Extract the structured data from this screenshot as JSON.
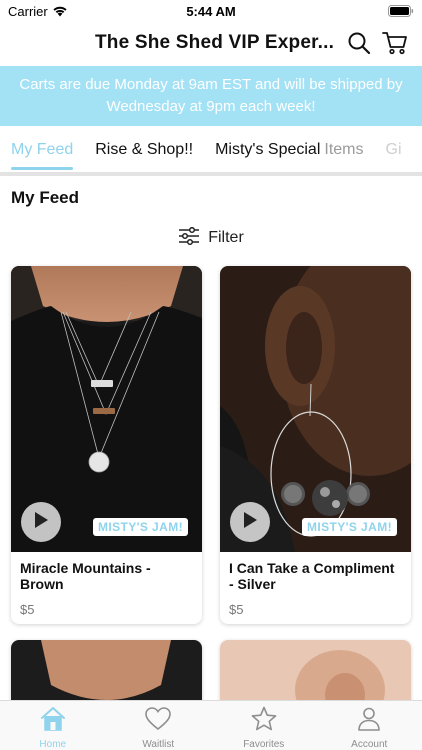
{
  "status_bar": {
    "carrier": "Carrier",
    "time": "5:44 AM"
  },
  "header": {
    "title": "The She Shed  VIP Exper..."
  },
  "banner": {
    "text": "Carts are due Monday at 9am EST and will be shipped by Wednesday at 9pm each week!"
  },
  "tabs": [
    {
      "label": "My Feed",
      "active": true
    },
    {
      "label": "Rise & Shop!!"
    },
    {
      "label_a": "Misty's Special ",
      "label_b": "Items"
    },
    {
      "label": "Gi"
    }
  ],
  "feed": {
    "title": "My Feed",
    "filter_label": "Filter"
  },
  "products": [
    {
      "title": "Miracle Mountains - Brown",
      "price": "$5",
      "badge": "MISTY'S JAM!"
    },
    {
      "title": "I Can Take a Compliment - Silver",
      "price": "$5",
      "badge": "MISTY'S JAM!"
    }
  ],
  "tab_bar": [
    {
      "label": "Home",
      "icon": "home-icon",
      "active": true
    },
    {
      "label": "Waitlist",
      "icon": "heart-icon"
    },
    {
      "label": "Favorites",
      "icon": "star-icon"
    },
    {
      "label": "Account",
      "icon": "person-icon"
    }
  ],
  "colors": {
    "accent": "#8fd3ec",
    "banner_bg": "#a3e1f5"
  }
}
